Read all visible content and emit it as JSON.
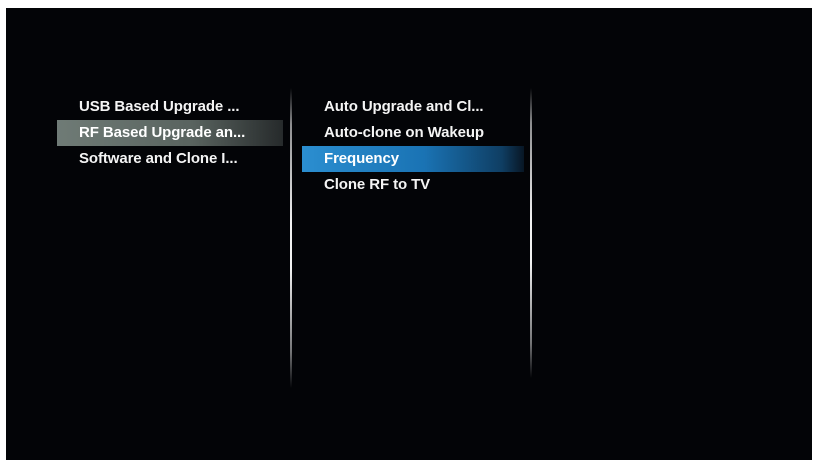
{
  "menu": {
    "left": [
      {
        "label": "USB Based Upgrade ..."
      },
      {
        "label": "RF Based Upgrade an..."
      },
      {
        "label": "Software and Clone I..."
      }
    ],
    "middle": [
      {
        "label": "Auto Upgrade and Cl..."
      },
      {
        "label": "Auto-clone on Wakeup"
      },
      {
        "label": "Frequency"
      },
      {
        "label": "Clone RF to TV"
      }
    ]
  },
  "colors": {
    "background": "#030407",
    "selected_item": "#6f7b76",
    "highlight_item": "#2b8ed0",
    "text": "#f4f4f4"
  }
}
